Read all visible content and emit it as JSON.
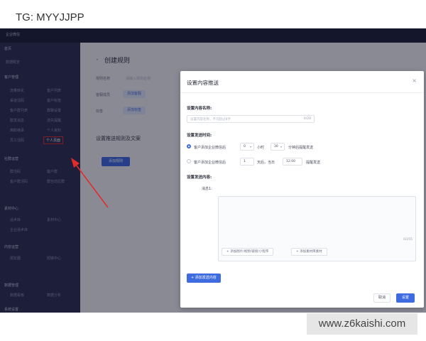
{
  "watermark_top": "TG: MYYJJPP",
  "watermark_bottom": "www.z6kaishi.com",
  "app": {
    "brand": "企业微信"
  },
  "sidebar": {
    "sections": [
      {
        "title": "首页",
        "items": [
          "数据概览"
        ]
      },
      {
        "title": "客户管理",
        "items": [
          "流量转化",
          "客户列表",
          "渠道活码",
          "客户标签",
          "客户群列表",
          "群聊设置",
          "群发消息",
          "流失提醒",
          "离职继承",
          "个人资料",
          "员工活码",
          "个人页面"
        ]
      },
      {
        "title": "社群运营",
        "items": [
          "群活码",
          "客户群",
          "客户群活码",
          "群自动拉群"
        ]
      },
      {
        "title": "素材中心",
        "items": [
          "话术库",
          "素材中心",
          "企业话术库"
        ]
      },
      {
        "title": "内容运营",
        "items": [
          "朋友圈",
          "短链中心"
        ]
      },
      {
        "title": "数据管理",
        "items": [
          "数据看板",
          "数据分析"
        ]
      },
      {
        "title": "系统设置",
        "items": []
      }
    ],
    "highlighted": "个人页面"
  },
  "main": {
    "title": "创建规则",
    "fields": [
      {
        "label": "规则名称",
        "value": "请输入规则名称"
      },
      {
        "label": "客服成员",
        "value": "添加客服"
      },
      {
        "label": "标签",
        "value": "添加标签"
      }
    ],
    "section_title": "设置推送规则及文案",
    "button": "添加规则"
  },
  "modal": {
    "title": "设置内容推送",
    "name_label": "设置内容名称:",
    "name_placeholder": "设置内容名称，不可超过8字",
    "name_count": "0/20",
    "time_label": "设置发送时间:",
    "option1": {
      "text": "客户添加企业微信后",
      "value": "0",
      "unit": "小时",
      "value2": "30",
      "suffix": "分钟后提醒发送"
    },
    "option2": {
      "text": "客户添加企业微信后",
      "value": "1",
      "unit": "天后，当日",
      "time": "12:00",
      "suffix": "提醒发送"
    },
    "content_label": "设置发送内容:",
    "message_label": "消息1:",
    "message_count": "0/255",
    "attach_buttons": [
      "+ 添加图片/视频/链接/小程序",
      "+ 添加素材库素材"
    ],
    "add_button": "+ 添加发送内容",
    "cancel": "取消",
    "confirm": "设置"
  }
}
